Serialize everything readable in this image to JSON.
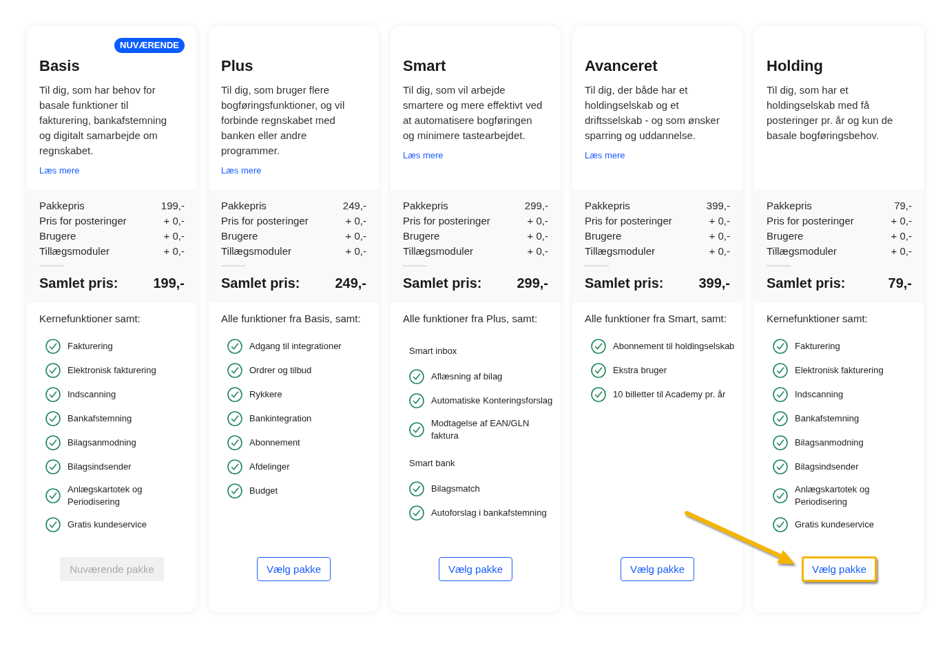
{
  "plans": [
    {
      "name": "Basis",
      "badge": "NUVÆRENDE",
      "description": "Til dig, som har behov for basale funktioner til fakturering, bankafstemning og digitalt samarbejde om regnskabet.",
      "link": "Læs mere",
      "prices": [
        {
          "label": "Pakkepris",
          "value": "199,-"
        },
        {
          "label": "Pris for posteringer",
          "value": "+ 0,-"
        },
        {
          "label": "Brugere",
          "value": "+ 0,-"
        },
        {
          "label": "Tillægsmoduler",
          "value": "+ 0,-"
        }
      ],
      "total_label": "Samlet pris:",
      "total": "199,-",
      "features_heading": "Kernefunktioner samt:",
      "features": [
        {
          "kind": "feature",
          "text": "Fakturering"
        },
        {
          "kind": "feature",
          "text": "Elektronisk fakturering"
        },
        {
          "kind": "feature",
          "text": "Indscanning"
        },
        {
          "kind": "feature",
          "text": "Bankafstemning"
        },
        {
          "kind": "feature",
          "text": "Bilagsanmodning"
        },
        {
          "kind": "feature",
          "text": "Bilagsindsender"
        },
        {
          "kind": "feature",
          "text": "Anlægskartotek og Periodisering"
        },
        {
          "kind": "feature",
          "text": "Gratis kundeservice"
        }
      ],
      "button": {
        "label": "Nuværende pakke",
        "disabled": true,
        "highlighted": false
      }
    },
    {
      "name": "Plus",
      "description": "Til dig, som bruger flere bogføringsfunktioner, og vil forbinde regnskabet med banken eller andre programmer.",
      "link": "Læs mere",
      "prices": [
        {
          "label": "Pakkepris",
          "value": "249,-"
        },
        {
          "label": "Pris for posteringer",
          "value": "+ 0,-"
        },
        {
          "label": "Brugere",
          "value": "+ 0,-"
        },
        {
          "label": "Tillægsmoduler",
          "value": "+ 0,-"
        }
      ],
      "total_label": "Samlet pris:",
      "total": "249,-",
      "features_heading": "Alle funktioner fra Basis, samt:",
      "features": [
        {
          "kind": "feature",
          "text": "Adgang til integrationer"
        },
        {
          "kind": "feature",
          "text": "Ordrer og tilbud"
        },
        {
          "kind": "feature",
          "text": "Rykkere"
        },
        {
          "kind": "feature",
          "text": "Bankintegration"
        },
        {
          "kind": "feature",
          "text": "Abonnement"
        },
        {
          "kind": "feature",
          "text": "Afdelinger"
        },
        {
          "kind": "feature",
          "text": "Budget"
        }
      ],
      "button": {
        "label": "Vælg pakke",
        "disabled": false,
        "highlighted": false
      }
    },
    {
      "name": "Smart",
      "description": "Til dig, som vil arbejde smartere og mere effektivt ved at automatisere bogføringen og minimere tastearbejdet.",
      "link": "Læs mere",
      "prices": [
        {
          "label": "Pakkepris",
          "value": "299,-"
        },
        {
          "label": "Pris for posteringer",
          "value": "+ 0,-"
        },
        {
          "label": "Brugere",
          "value": "+ 0,-"
        },
        {
          "label": "Tillægsmoduler",
          "value": "+ 0,-"
        }
      ],
      "total_label": "Samlet pris:",
      "total": "299,-",
      "features_heading": "Alle funktioner fra Plus, samt:",
      "features": [
        {
          "kind": "group",
          "text": "Smart inbox"
        },
        {
          "kind": "feature",
          "text": "Aflæsning af bilag"
        },
        {
          "kind": "feature",
          "text": "Automatiske Konteringsforslag"
        },
        {
          "kind": "feature",
          "text": "Modtagelse af EAN/GLN faktura"
        },
        {
          "kind": "group",
          "text": "Smart bank"
        },
        {
          "kind": "feature",
          "text": "Bilagsmatch"
        },
        {
          "kind": "feature",
          "text": "Autoforslag i bankafstemning"
        }
      ],
      "button": {
        "label": "Vælg pakke",
        "disabled": false,
        "highlighted": false
      }
    },
    {
      "name": "Avanceret",
      "description": "Til dig, der både har et holdingselskab og et driftsselskab - og som ønsker sparring og uddannelse.",
      "link": "Læs mere",
      "prices": [
        {
          "label": "Pakkepris",
          "value": "399,-"
        },
        {
          "label": "Pris for posteringer",
          "value": "+ 0,-"
        },
        {
          "label": "Brugere",
          "value": "+ 0,-"
        },
        {
          "label": "Tillægsmoduler",
          "value": "+ 0,-"
        }
      ],
      "total_label": "Samlet pris:",
      "total": "399,-",
      "features_heading": "Alle funktioner fra Smart, samt:",
      "features": [
        {
          "kind": "feature",
          "text": "Abonnement til holdingselskab"
        },
        {
          "kind": "feature",
          "text": "Ekstra bruger"
        },
        {
          "kind": "feature",
          "text": "10 billetter til Academy pr. år"
        }
      ],
      "button": {
        "label": "Vælg pakke",
        "disabled": false,
        "highlighted": false
      }
    },
    {
      "name": "Holding",
      "description": "Til dig, som har et holdingselskab med få posteringer pr. år og kun de basale bogføringsbehov.",
      "prices": [
        {
          "label": "Pakkepris",
          "value": "79,-"
        },
        {
          "label": "Pris for posteringer",
          "value": "+ 0,-"
        },
        {
          "label": "Brugere",
          "value": "+ 0,-"
        },
        {
          "label": "Tillægsmoduler",
          "value": "+ 0,-"
        }
      ],
      "total_label": "Samlet pris:",
      "total": "79,-",
      "features_heading": "Kernefunktioner samt:",
      "features": [
        {
          "kind": "feature",
          "text": "Fakturering"
        },
        {
          "kind": "feature",
          "text": "Elektronisk fakturering"
        },
        {
          "kind": "feature",
          "text": "Indscanning"
        },
        {
          "kind": "feature",
          "text": "Bankafstemning"
        },
        {
          "kind": "feature",
          "text": "Bilagsanmodning"
        },
        {
          "kind": "feature",
          "text": "Bilagsindsender"
        },
        {
          "kind": "feature",
          "text": "Anlægskartotek og Periodisering"
        },
        {
          "kind": "feature",
          "text": "Gratis kundeservice"
        }
      ],
      "button": {
        "label": "Vælg pakke",
        "disabled": false,
        "highlighted": true
      }
    }
  ]
}
